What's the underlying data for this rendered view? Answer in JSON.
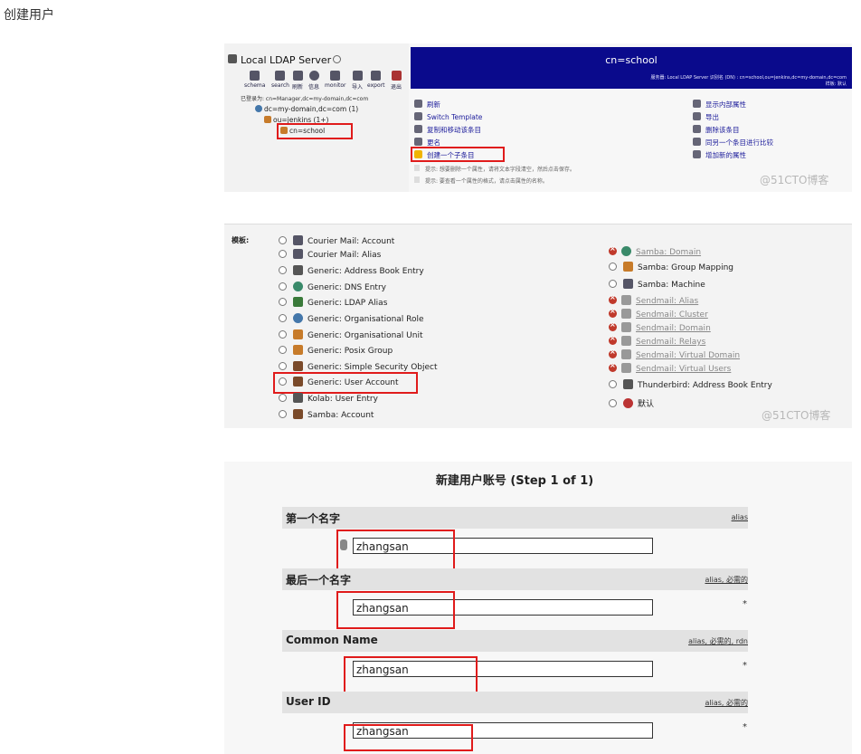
{
  "page_title": "创建用户",
  "panel1": {
    "server_title": "Local LDAP Server",
    "toolbar": [
      "schema",
      "search",
      "刷新",
      "信息",
      "monitor",
      "导入",
      "export",
      "退出"
    ],
    "login_text": "已登录为: cn=Manager,dc=my-domain,dc=com",
    "tree": [
      "dc=my-domain,dc=com (1)",
      "ou=jenkins (1+)",
      "cn=school"
    ],
    "header_title": "cn=school",
    "header_info": "服务器: Local LDAP Server   识别名 (DN) : cn=school,ou=jenkins,dc=my-domain,dc=com",
    "header_info2": "样板: 默认",
    "actions_left": [
      "刷新",
      "Switch Template",
      "复制和移动该条目",
      "更名",
      "创建一个子条目"
    ],
    "actions_right": [
      "显示内部属性",
      "导出",
      "删除该条目",
      "同另一个条目进行比较",
      "增加新的属性"
    ],
    "hints": [
      "提示:  想要删除一个属性，请将文本字段清空，然后点击保存。",
      "提示:  要查看一个属性的格式，请点击属性的名称。"
    ],
    "watermark": "@51CTO博客"
  },
  "panel2": {
    "label": "模板:",
    "left_options": [
      "Courier Mail: Account",
      "Courier Mail: Alias",
      "Generic: Address Book Entry",
      "Generic: DNS Entry",
      "Generic: LDAP Alias",
      "Generic: Organisational Role",
      "Generic: Organisational Unit",
      "Generic: Posix Group",
      "Generic: Simple Security Object",
      "Generic: User Account",
      "Kolab: User Entry",
      "Samba: Account"
    ],
    "right_options": [
      {
        "label": "Samba: Domain",
        "disabled": true
      },
      {
        "label": "Samba: Group Mapping",
        "disabled": false
      },
      {
        "label": "Samba: Machine",
        "disabled": false
      },
      {
        "label": "Sendmail: Alias",
        "disabled": true
      },
      {
        "label": "Sendmail: Cluster",
        "disabled": true
      },
      {
        "label": "Sendmail: Domain",
        "disabled": true
      },
      {
        "label": "Sendmail: Relays",
        "disabled": true
      },
      {
        "label": "Sendmail: Virtual Domain",
        "disabled": true
      },
      {
        "label": "Sendmail: Virtual Users",
        "disabled": true
      },
      {
        "label": "Thunderbird: Address Book Entry",
        "disabled": false
      },
      {
        "label": "默认",
        "disabled": false
      }
    ],
    "watermark": "@51CTO博客"
  },
  "panel3": {
    "title": "新建用户账号 (Step 1 of 1)",
    "fields": [
      {
        "label": "第一个名字",
        "tags": "alias",
        "value": "zhangsan",
        "required": ""
      },
      {
        "label": "最后一个名字",
        "tags": "alias, 必需的",
        "value": "zhangsan",
        "required": "*"
      },
      {
        "label": "Common Name",
        "tags": "alias, 必需的, rdn",
        "value": "zhangsan",
        "required": "*"
      },
      {
        "label": "User ID",
        "tags": "alias, 必需的",
        "value": "zhangsan",
        "required": "*"
      }
    ]
  },
  "colors": {
    "header_bg": "#0a0a8c",
    "highlight": "#e01b1b",
    "link": "#1a1a9a"
  }
}
